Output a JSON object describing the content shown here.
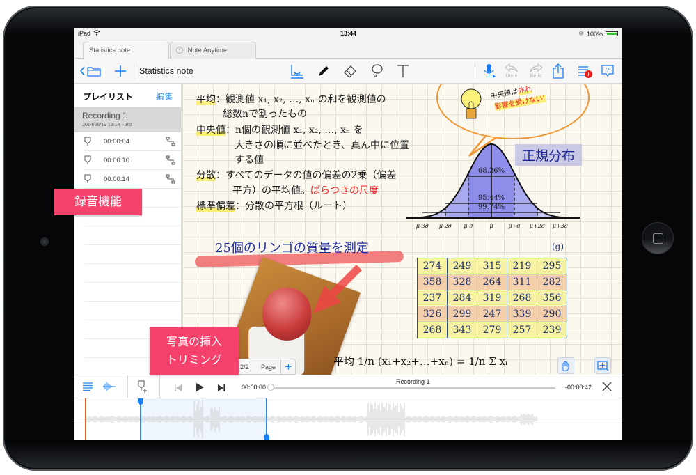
{
  "status_bar": {
    "device": "iPad",
    "time": "13:44",
    "battery": "100%",
    "battery_level": 1.0
  },
  "tabs": [
    {
      "label": "Statistics note",
      "active": true
    },
    {
      "label": "Note Anytime",
      "active": false
    }
  ],
  "toolbar": {
    "document_title": "Statistics note",
    "left_icons": [
      "back-folder-icon",
      "add-icon"
    ],
    "tools": [
      "view-mode-icon",
      "pen-icon",
      "eraser-icon",
      "lasso-icon",
      "text-icon"
    ],
    "active_tool": "view-mode-icon",
    "undo_label": "Undo",
    "redo_label": "Redo",
    "right_icons": [
      "microphone-icon",
      "undo-icon",
      "redo-icon",
      "share-icon",
      "menu-icon",
      "help-icon"
    ],
    "menu_badge": "i"
  },
  "sidebar": {
    "title": "プレイリスト",
    "edit_label": "編集",
    "recording": {
      "name": "Recording 1",
      "meta": "2014/06/19 13:14 - test"
    },
    "markers": [
      {
        "time": "00:00:04"
      },
      {
        "time": "00:00:10"
      },
      {
        "time": "00:00:14"
      }
    ]
  },
  "note": {
    "definitions": [
      {
        "term": "平均",
        "line1": "：観測値 x₁, x₂, …, xₙ の和を観測値の",
        "line2": "総数nで割ったもの"
      },
      {
        "term": "中央値",
        "line1": "：n個の観測値 x₁, x₂, …, xₙ を",
        "line2": "大きさの順に並べたとき、真ん中に位置",
        "line3": "する値"
      },
      {
        "term": "分散",
        "line1": "：すべてのデータの値の偏差の2乗（偏差",
        "line2": "平方）の平均値。",
        "line2_red": "ばらつきの尺度"
      },
      {
        "term": "標準偏差",
        "line1": "：分散の平方根（ルート）"
      }
    ],
    "callout_line1": "中央値は",
    "callout_line1_hl": "外れ",
    "callout_line2": "影響を受けない!",
    "normal_distribution_title": "正規分布",
    "distribution_labels": [
      "68.26%",
      "95.44%",
      "99.74%"
    ],
    "axis_labels": [
      "μ-3σ",
      "μ-2σ",
      "μ-σ",
      "μ",
      "μ+σ",
      "μ+2σ",
      "μ+3σ"
    ],
    "measure_title": "25個のリンゴの質量を測定",
    "unit": "(g)",
    "apple_weights": [
      [
        274,
        249,
        315,
        219,
        295
      ],
      [
        358,
        328,
        264,
        311,
        282
      ],
      [
        237,
        284,
        319,
        268,
        356
      ],
      [
        326,
        299,
        247,
        339,
        290
      ],
      [
        268,
        343,
        279,
        257,
        239
      ]
    ],
    "formula": "平均  1/n (x₁+x₂+…+xₙ) = 1/n Σ xᵢ",
    "page_indicator": "2/2",
    "page_label": "Page"
  },
  "audio": {
    "current_time": "00:00:00",
    "remaining_time": "-00:00:42",
    "title": "Recording 1",
    "progress": 0.0,
    "selection_start_fraction": 0.12,
    "selection_end_fraction": 0.35
  },
  "annotations": {
    "recording_feature": "録音機能",
    "photo_line1": "写真の挿入",
    "photo_line2": "トリミング"
  }
}
